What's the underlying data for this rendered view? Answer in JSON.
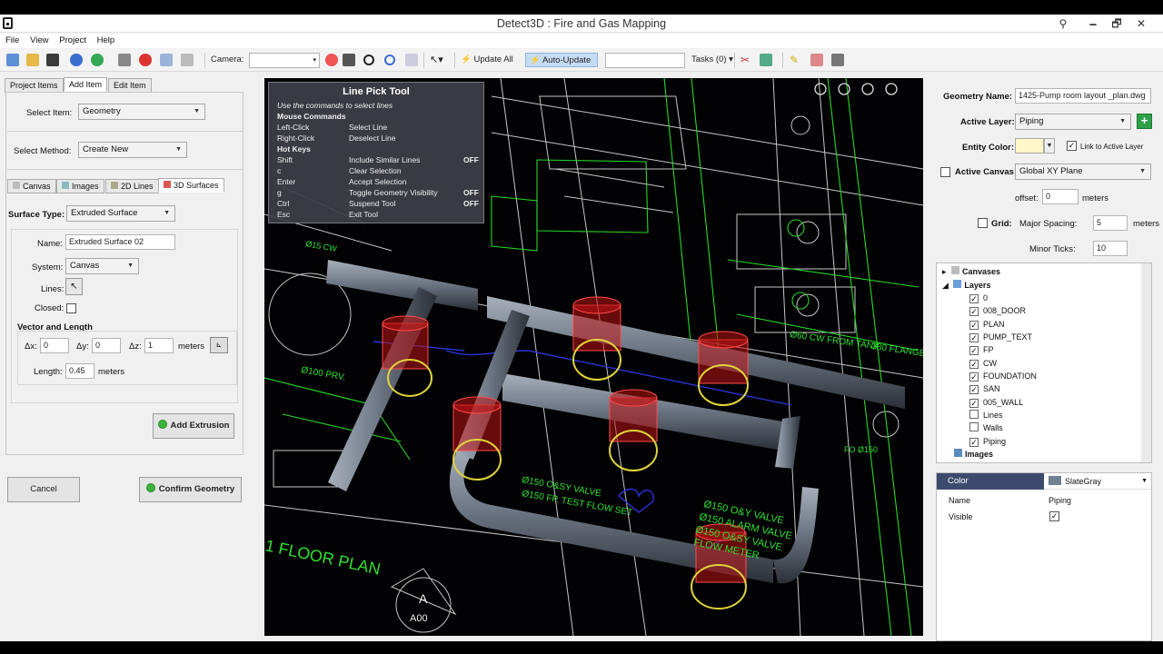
{
  "window": {
    "title": "Detect3D : Fire and Gas Mapping",
    "min_glyph": "🗕",
    "max_glyph": "🗗",
    "close_glyph": "✕",
    "pin_glyph": "⚲"
  },
  "menu": [
    "File",
    "View",
    "Project",
    "Help"
  ],
  "toolbar": {
    "camera_label": "Camera:",
    "update_all": "Update All",
    "auto_update": "Auto-Update",
    "tasks": "Tasks (0)"
  },
  "left": {
    "tabs": [
      "Project Items",
      "Add Item",
      "Edit Item"
    ],
    "select_item_label": "Select Item:",
    "select_item_value": "Geometry",
    "select_method_label": "Select Method:",
    "select_method_value": "Create New",
    "subtabs": [
      "Canvas",
      "Images",
      "2D Lines",
      "3D Surfaces"
    ],
    "surface_type_label": "Surface Type:",
    "surface_type_value": "Extruded Surface",
    "name_label": "Name:",
    "name_value": "Extruded Surface 02",
    "system_label": "System:",
    "system_value": "Canvas",
    "lines_label": "Lines:",
    "closed_label": "Closed:",
    "vector_header": "Vector and Length",
    "dx_label": "Δx:",
    "dx_value": "0",
    "dy_label": "Δy:",
    "dy_value": "0",
    "dz_label": "Δz:",
    "dz_value": "1",
    "meters": "meters",
    "length_label": "Length:",
    "length_value": "0.45",
    "add_extrusion": "Add Extrusion",
    "cancel": "Cancel",
    "confirm": "Confirm Geometry"
  },
  "pick": {
    "title": "Line Pick Tool",
    "subtitle": "Use the commands to select lines",
    "mouse_header": "Mouse Commands",
    "mouse": [
      {
        "key": "Left-Click",
        "action": "Select Line"
      },
      {
        "key": "Right-Click",
        "action": "Deselect Line"
      }
    ],
    "hot_header": "Hot Keys",
    "hot": [
      {
        "key": "Shift",
        "action": "Include Similar Lines",
        "state": "OFF"
      },
      {
        "key": "c",
        "action": "Clear Selection",
        "state": ""
      },
      {
        "key": "Enter",
        "action": "Accept Selection",
        "state": ""
      },
      {
        "key": "g",
        "action": "Toggle Geometry Visibility",
        "state": "OFF"
      },
      {
        "key": "Ctrl",
        "action": "Suspend Tool",
        "state": "OFF"
      },
      {
        "key": "Esc",
        "action": "Exit Tool",
        "state": ""
      }
    ]
  },
  "cad_text": [
    "Ø150 O&Y VALVE",
    "Ø150 ALARM VALVE",
    "Ø150 O&SY VALVE",
    "FLOW METER",
    "Ø150 FP. TEST FLOW SET",
    "Ø150 O&SY VALVE",
    "1 FLOOR PLAN",
    "Ø60 CW FROM TANK",
    "380 FLANGE",
    "Ø100 PRV.",
    "Ø15 CW",
    "A",
    "A00",
    "FO Ø150"
  ],
  "right": {
    "geom_name_label": "Geometry Name:",
    "geom_name_value": "1425-Pump room layout _plan.dwg",
    "active_layer_label": "Active Layer:",
    "active_layer_value": "Piping",
    "entity_color_label": "Entity Color:",
    "link_label": "Link to Active Layer",
    "active_canvas_label": "Active Canvas:",
    "active_canvas_value": "Global XY Plane",
    "offset_label": "offset:",
    "offset_value": "0",
    "meters": "meters",
    "grid_label": "Grid:",
    "major_label": "Major Spacing:",
    "major_value": "5",
    "minor_label": "Minor Ticks:",
    "minor_value": "10",
    "tree": {
      "canvases": "Canvases",
      "layers": "Layers",
      "images": "Images",
      "layer_items": [
        {
          "name": "0",
          "checked": true
        },
        {
          "name": "008_DOOR",
          "checked": true
        },
        {
          "name": "PLAN",
          "checked": true
        },
        {
          "name": "PUMP_TEXT",
          "checked": true
        },
        {
          "name": "FP",
          "checked": true
        },
        {
          "name": "CW",
          "checked": true
        },
        {
          "name": "FOUNDATION",
          "checked": true
        },
        {
          "name": "SAN",
          "checked": true
        },
        {
          "name": "005_WALL",
          "checked": true
        },
        {
          "name": "Lines",
          "checked": false
        },
        {
          "name": "Walls",
          "checked": false
        },
        {
          "name": "Piping",
          "checked": true
        }
      ]
    },
    "props": {
      "color_label": "Color",
      "color_value": "SlateGray",
      "name_label": "Name",
      "name_value": "Piping",
      "visible_label": "Visible"
    },
    "colors": {
      "slategray": "#708090",
      "entity": "#fff7c8"
    }
  }
}
